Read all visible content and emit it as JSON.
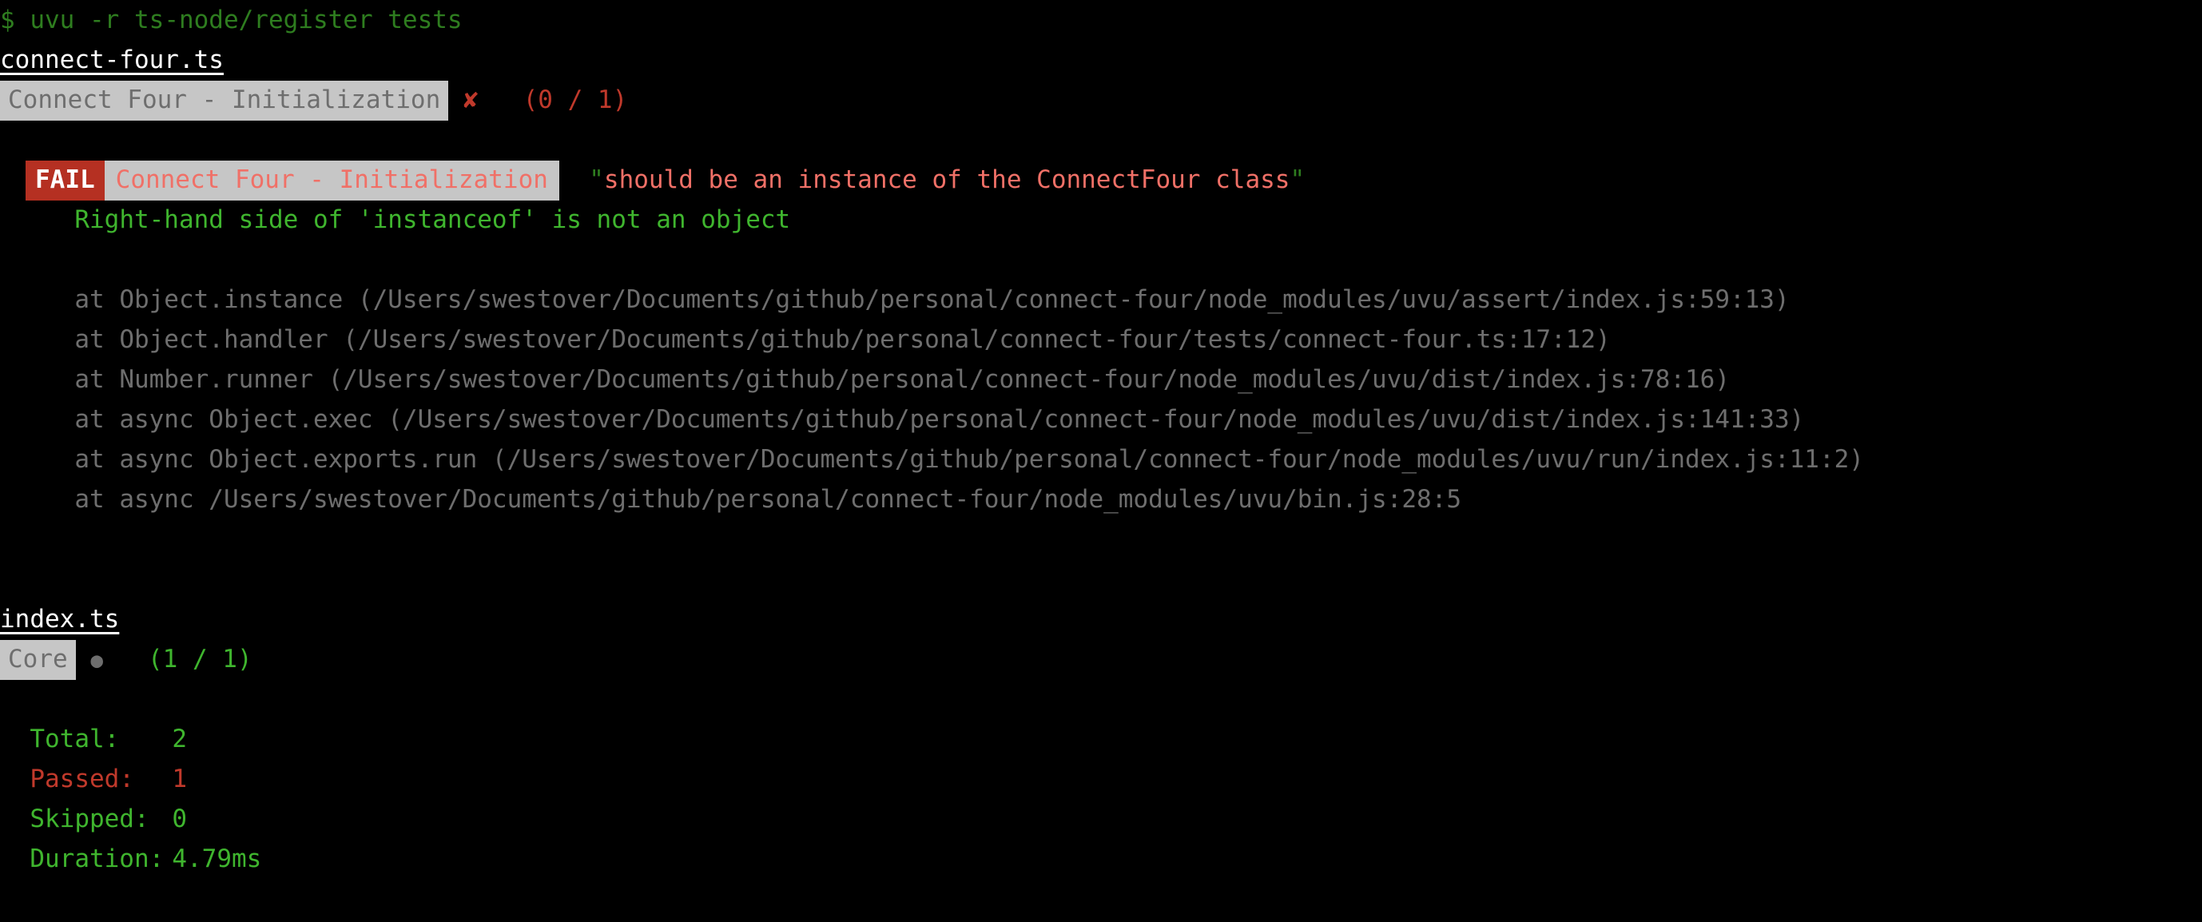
{
  "terminal": {
    "prompt_symbol": "$",
    "command": "uvu -r ts-node/register tests"
  },
  "suites": [
    {
      "file": "connect-four.ts",
      "name": "Connect Four - Initialization",
      "status_marker": "✘",
      "status": "fail",
      "counts": "(0 / 1)",
      "failure": {
        "badge": "FAIL",
        "suite": "Connect Four - Initialization",
        "test_name": "should be an instance of the ConnectFour class",
        "quote_open": "\"",
        "quote_close": "\"",
        "message": "Right-hand side of 'instanceof' is not an object",
        "stack": [
          "at Object.instance (/Users/swestover/Documents/github/personal/connect-four/node_modules/uvu/assert/index.js:59:13)",
          "at Object.handler (/Users/swestover/Documents/github/personal/connect-four/tests/connect-four.ts:17:12)",
          "at Number.runner (/Users/swestover/Documents/github/personal/connect-four/node_modules/uvu/dist/index.js:78:16)",
          "at async Object.exec (/Users/swestover/Documents/github/personal/connect-four/node_modules/uvu/dist/index.js:141:33)",
          "at async Object.exports.run (/Users/swestover/Documents/github/personal/connect-four/node_modules/uvu/run/index.js:11:2)",
          "at async /Users/swestover/Documents/github/personal/connect-four/node_modules/uvu/bin.js:28:5"
        ]
      }
    },
    {
      "file": "index.ts",
      "name": "Core",
      "status_marker": "●",
      "status": "pass",
      "counts": "(1 / 1)"
    }
  ],
  "summary": {
    "total_label": "Total:",
    "total_value": "2",
    "passed_label": "Passed:",
    "passed_value": "1",
    "skipped_label": "Skipped:",
    "skipped_value": "0",
    "duration_label": "Duration:",
    "duration_value": "4.79ms"
  },
  "colors": {
    "background": "#000000",
    "prompt_green": "#2e7d1f",
    "bright_green": "#3fb52e",
    "fail_red": "#b53022",
    "salmon": "#f07067",
    "dim_gray": "#6e6e6e",
    "chip_gray": "#c6c6c6",
    "white": "#ffffff"
  }
}
